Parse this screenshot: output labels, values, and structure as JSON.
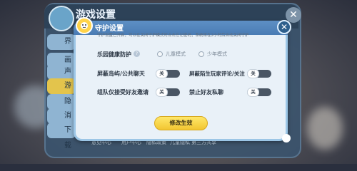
{
  "background_panel": {
    "title": "游戏设置",
    "side_tabs": [
      "界面",
      "画面",
      "声音",
      "游戏",
      "隐私",
      "消息",
      "下载"
    ],
    "selected_tab_index": 3,
    "bottom_links": [
      "意见中心",
      "用户中心",
      "隐私政策",
      "儿童隐私",
      "第三方共享"
    ]
  },
  "dialog": {
    "title": "守护设置",
    "note": "守护设置已开启，可以在关闭守护模式时点击忘记密码，系统将在2小时后自动关闭守护",
    "rows": [
      {
        "label": "乐园健康防护",
        "options": [
          "儿童模式",
          "少年模式"
        ]
      },
      {
        "left_label": "屏蔽岛屿/公共聊天",
        "left_state": "关",
        "right_label": "屏蔽陌生玩家评论/关注",
        "right_state": "关"
      },
      {
        "left_label": "组队仅接受好友邀请",
        "left_state": "关",
        "right_label": "禁止好友私聊",
        "right_state": "关"
      }
    ],
    "submit_label": "修改生效",
    "close_icon": "close-icon",
    "help_icon_text": "?"
  },
  "colors": {
    "header": "#4a7cb4",
    "submit": "#f2c531",
    "toggle_off": "#4a5664"
  }
}
